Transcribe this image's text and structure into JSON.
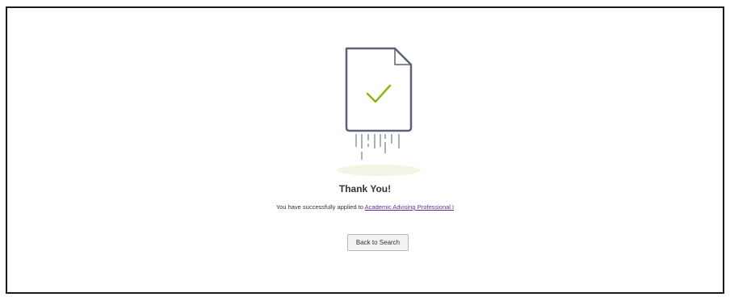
{
  "confirmation": {
    "title": "Thank You!",
    "message_prefix": "You have successfully applied to",
    "job_link": "Academic Advising Professional I"
  },
  "actions": {
    "back_to_search": "Back to Search"
  },
  "illustration": {
    "icon": "document-check-icon",
    "stroke_color": "#5b6472",
    "check_color": "#8bb614",
    "shadow_color": "#f2f4e4"
  }
}
